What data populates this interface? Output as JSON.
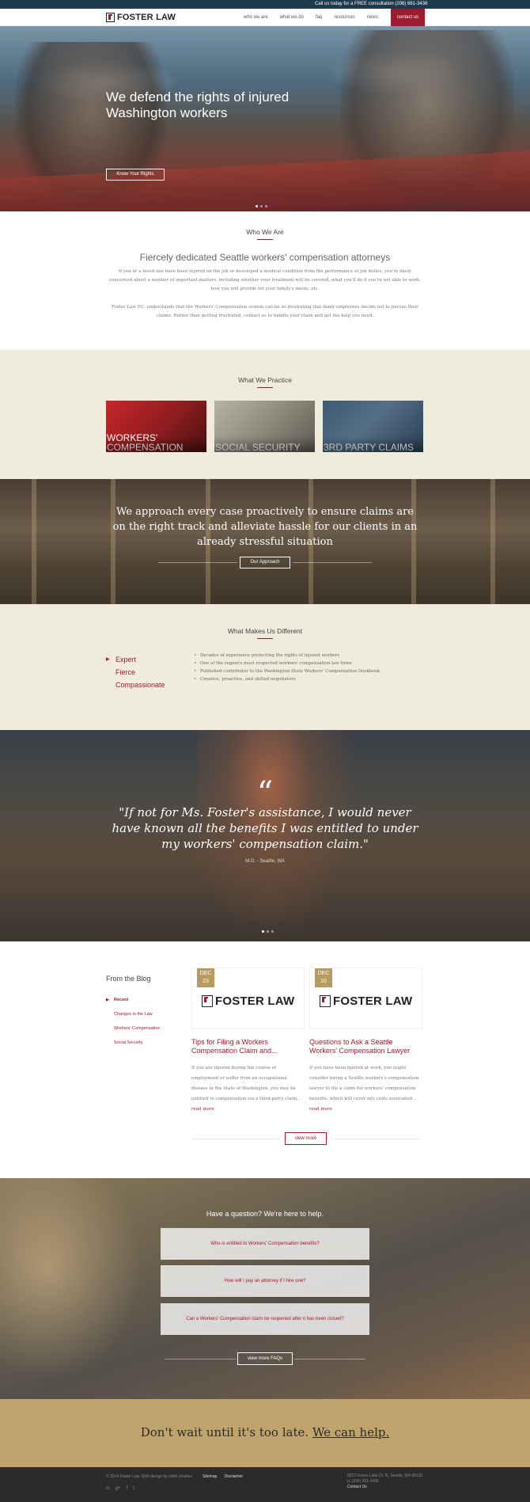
{
  "topbar": {
    "text": "Call us today for a FREE consultation (206) 661-3436"
  },
  "header": {
    "logo": "FOSTER LAW",
    "nav": [
      "who we are",
      "what we do",
      "faq",
      "resources",
      "news"
    ],
    "contact": "contact us"
  },
  "hero": {
    "title": "We defend the rights of injured Washington workers",
    "button": "Know Your Rights"
  },
  "who": {
    "title": "Who We Are",
    "subtitle": "Fiercely dedicated Seattle workers' compensation attorneys",
    "p1": "If you or a loved one have been injured on the job or developed a medical condition from the performance of job duties, you're likely concerned about a number of important matters, including whether your treatment will be covered, what you'll do if you're not able to work, how you will provide for your family's needs, etc.",
    "p2": "Foster Law P.C. understands that the Workers' Compensation system can be so frustrating that many employees decide not to pursue their claims. Rather than getting frustrated, contact us to handle your claim and get the help you need."
  },
  "practice": {
    "title": "What We Practice",
    "tiles": [
      "WORKERS' COMPENSATION",
      "SOCIAL SECURITY",
      "3RD PARTY CLAIMS"
    ]
  },
  "approach": {
    "text": "We approach every case proactively to ensure claims are on the right track and alleviate hassle for our clients in an already stressful situation",
    "button": "Our Approach"
  },
  "different": {
    "title": "What Makes Us Different",
    "items": [
      "Expert",
      "Fierce",
      "Compassionate"
    ],
    "bullets": [
      "Decades of experience protecting the rights of injured workers",
      "One of the region's most respected workers' compensation law firms",
      "Published contributor to the Washington State Workers' Compensation Deskbook",
      "Creative, proactive, and skilled negotiators"
    ]
  },
  "testimonial": {
    "mark": "“",
    "quote": "\"If not for Ms. Foster's assistance, I would never have known all the benefits I was entitled to under my workers' compensation claim.\"",
    "author": "M.G. - Seattle, WA"
  },
  "blog": {
    "title": "From the Blog",
    "categories": [
      "Recent",
      "Changes in the Law",
      "Workers' Compensation",
      "Social Security"
    ],
    "posts": [
      {
        "month": "DEC",
        "day": "23",
        "logo": "FOSTER LAW",
        "title": "Tips for Filing a Workers Compensation Claim and...",
        "body": "If you are injured during the course of employment or suffer from an occupational disease in the State of Washington, you may be entitled to compensation via a third-party claim...",
        "more": "read more"
      },
      {
        "month": "DEC",
        "day": "10",
        "logo": "FOSTER LAW",
        "title": "Questions to Ask a Seattle Workers' Compensation Lawyer",
        "body": "If you have been injured at work, you might consider hiring a Seattle workers's compensation lawyer to file a claim for workers' compensation benefits, which will cover any costs associated...",
        "more": "read more"
      }
    ],
    "view_more": "view more"
  },
  "faq": {
    "title": "Have a question? We're here to help.",
    "items": [
      "Who is entitled to Workers' Compensation benefits?",
      "How will I pay an attorney if I hire one?",
      "Can a Workers' Compensation claim be reopened after it has been closed?"
    ],
    "button": "view more FAQs"
  },
  "cta": {
    "text": "Don't wait until it's too late.",
    "link": "We can help."
  },
  "footer": {
    "copyright": "© 2014 Foster Law. Web design by ebbb creative",
    "links": [
      "Sitemap",
      "Disclaimer"
    ],
    "social": [
      "in",
      "g+",
      "f",
      "t"
    ],
    "address": "8012 Green Lake Dr. N, Seattle, WA 98103",
    "phone": "p: (206) 661-3436",
    "contact": "Contact Us"
  },
  "colors": {
    "accent": "#9b1b30",
    "gold": "#c1a46d",
    "cream": "#efebdd",
    "topbar": "#1f3a4d"
  }
}
